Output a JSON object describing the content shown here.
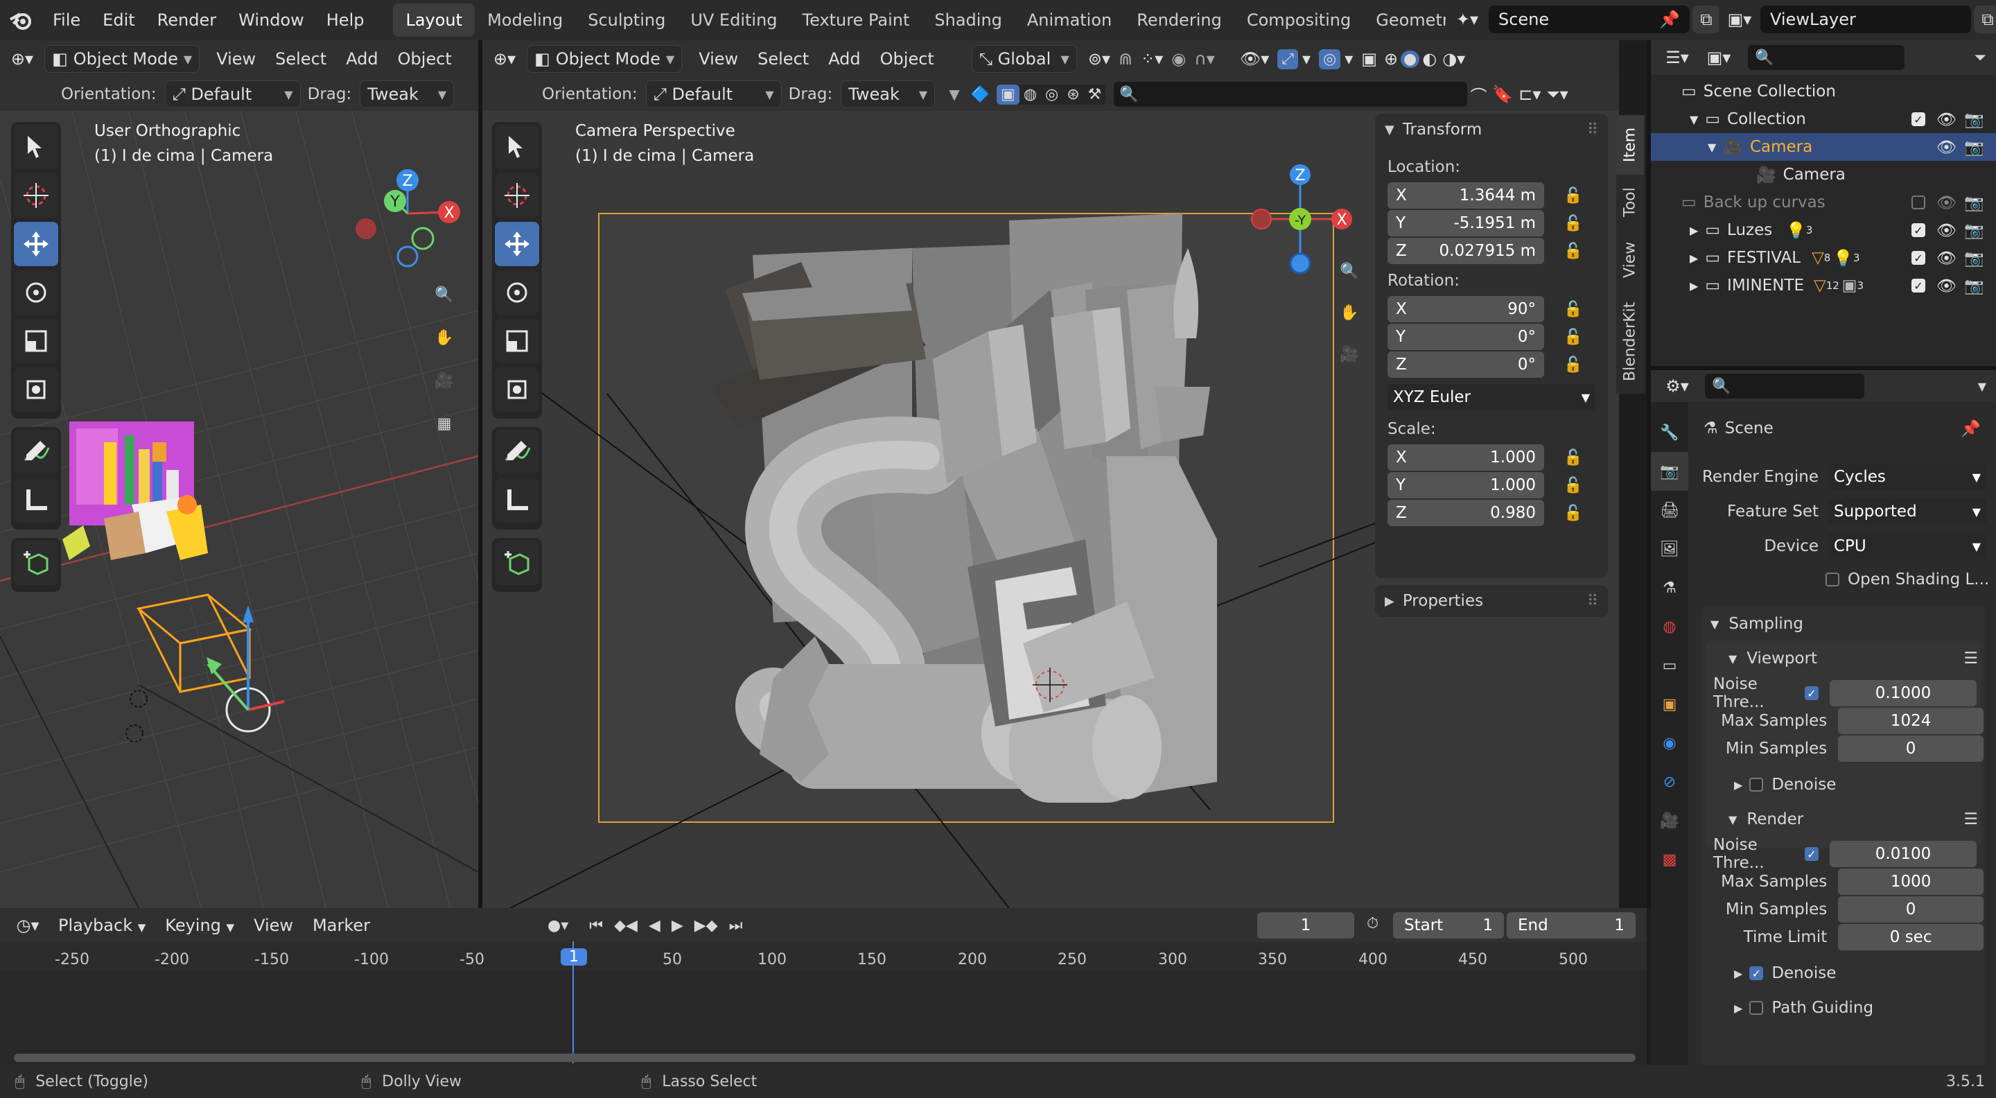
{
  "menu": {
    "file": "File",
    "edit": "Edit",
    "render": "Render",
    "window": "Window",
    "help": "Help"
  },
  "workspaces": [
    "Layout",
    "Modeling",
    "Sculpting",
    "UV Editing",
    "Texture Paint",
    "Shading",
    "Animation",
    "Rendering",
    "Compositing",
    "Geometry Nodes"
  ],
  "scene_field": "Scene",
  "viewlayer_field": "ViewLayer",
  "left_view": {
    "mode": "Object Mode",
    "menus": [
      "View",
      "Select",
      "Add",
      "Object"
    ],
    "orientation_label": "Orientation:",
    "orientation": "Default",
    "drag_label": "Drag:",
    "drag": "Tweak",
    "title": "User Orthographic",
    "subtitle": "(1) I de cima | Camera"
  },
  "main_view": {
    "mode": "Object Mode",
    "menus": [
      "View",
      "Select",
      "Add",
      "Object"
    ],
    "transform_orientation": "Global",
    "orientation_label": "Orientation:",
    "orientation": "Default",
    "drag_label": "Drag:",
    "drag": "Tweak",
    "title": "Camera Perspective",
    "subtitle": "(1) I de cima | Camera"
  },
  "gizmo": {
    "x": "X",
    "y": "Y",
    "z": "Z",
    "neg_y": "-Y"
  },
  "npanel": {
    "tabs": [
      "Item",
      "Tool",
      "View",
      "BlenderKit"
    ],
    "transform_title": "Transform",
    "location_label": "Location:",
    "location": [
      {
        "axis": "X",
        "value": "1.3644 m"
      },
      {
        "axis": "Y",
        "value": "-5.1951 m"
      },
      {
        "axis": "Z",
        "value": "0.027915 m"
      }
    ],
    "rotation_label": "Rotation:",
    "rotation": [
      {
        "axis": "X",
        "value": "90°"
      },
      {
        "axis": "Y",
        "value": "0°"
      },
      {
        "axis": "Z",
        "value": "0°"
      }
    ],
    "rotation_mode": "XYZ Euler",
    "scale_label": "Scale:",
    "scale": [
      {
        "axis": "X",
        "value": "1.000"
      },
      {
        "axis": "Y",
        "value": "1.000"
      },
      {
        "axis": "Z",
        "value": "0.980"
      }
    ],
    "properties_title": "Properties"
  },
  "outliner": {
    "items": [
      {
        "label": "Scene Collection"
      },
      {
        "label": "Collection"
      },
      {
        "label": "Camera"
      },
      {
        "label": "Camera"
      },
      {
        "label": "Back up curvas"
      },
      {
        "label": "Luzes",
        "badge": "3"
      },
      {
        "label": "FESTIVAL",
        "badge": "8",
        "badge2": "3"
      },
      {
        "label": "IMINENTE",
        "badge": "12",
        "badge2": "3"
      }
    ]
  },
  "properties": {
    "context": "Scene",
    "render_engine_label": "Render Engine",
    "render_engine": "Cycles",
    "feature_set_label": "Feature Set",
    "feature_set": "Supported",
    "device_label": "Device",
    "device": "CPU",
    "osl_label": "Open Shading L...",
    "sampling_title": "Sampling",
    "viewport_title": "Viewport",
    "vp_noise_label": "Noise Thre...",
    "vp_noise": "0.1000",
    "vp_max_label": "Max Samples",
    "vp_max": "1024",
    "vp_min_label": "Min Samples",
    "vp_min": "0",
    "vp_denoise": "Denoise",
    "render_title": "Render",
    "r_noise_label": "Noise Thre...",
    "r_noise": "0.0100",
    "r_max_label": "Max Samples",
    "r_max": "1000",
    "r_min_label": "Min Samples",
    "r_min": "0",
    "r_time_label": "Time Limit",
    "r_time": "0 sec",
    "r_denoise": "Denoise",
    "path_guiding": "Path Guiding"
  },
  "timeline": {
    "menus": [
      "Playback",
      "Keying",
      "View",
      "Marker"
    ],
    "current_frame": "1",
    "start_label": "Start",
    "start": "1",
    "end_label": "End",
    "end": "1",
    "ticks": [
      "-250",
      "-200",
      "-150",
      "-100",
      "-50",
      "1",
      "50",
      "100",
      "150",
      "200",
      "250",
      "300",
      "350",
      "400",
      "450",
      "500"
    ]
  },
  "statusbar": {
    "select": "Select (Toggle)",
    "dolly": "Dolly View",
    "lasso": "Lasso Select",
    "version": "3.5.1"
  }
}
